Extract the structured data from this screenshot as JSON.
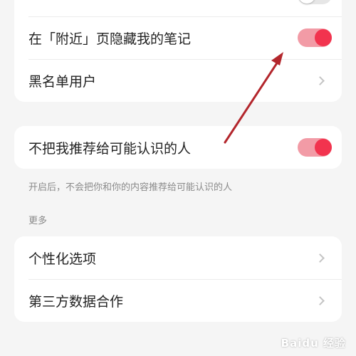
{
  "privacy_card": {
    "top_row_label": "",
    "top_row_toggle_on": false,
    "hide_in_nearby_label": "在「附近」页隐藏我的笔记",
    "hide_in_nearby_on": true,
    "blacklist_label": "黑名单用户"
  },
  "recommend_card": {
    "label": "不把我推荐给可能认识的人",
    "toggle_on": true,
    "hint": "开启后，不会把你和你的内容推荐给可能认识的人"
  },
  "more_section": {
    "title": "更多",
    "items": [
      {
        "label": "个性化选项"
      },
      {
        "label": "第三方数据合作"
      }
    ]
  },
  "colors": {
    "accent": "#f2334e",
    "accent_track": "#f29ba6",
    "annotation_arrow": "#b3262c"
  },
  "watermark": "Baidu 经验"
}
